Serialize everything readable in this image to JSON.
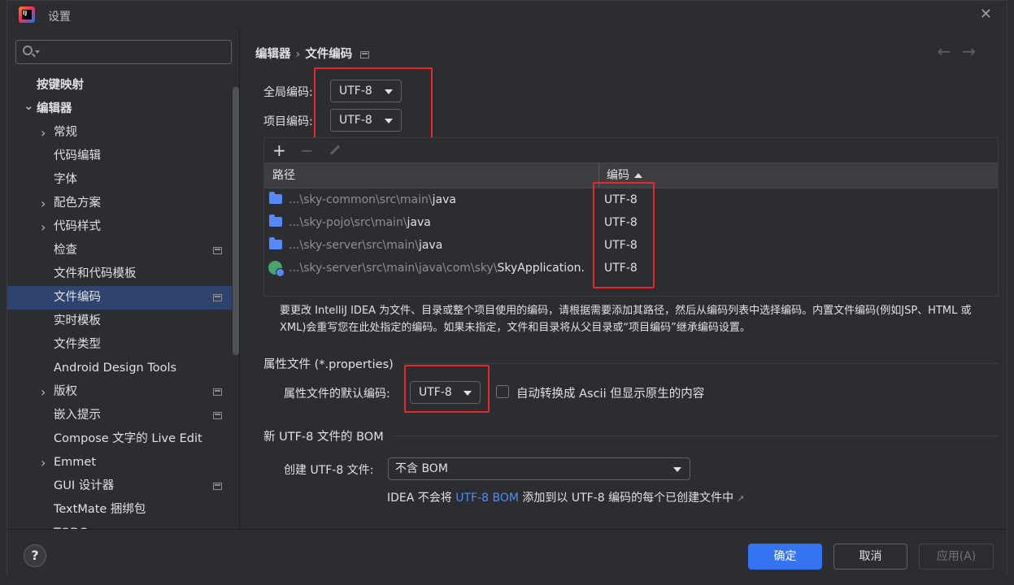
{
  "window": {
    "title": "设置"
  },
  "sidebar": {
    "search_placeholder": "",
    "items": [
      {
        "label": "按键映射",
        "level": 0,
        "bold": true,
        "chevron": ""
      },
      {
        "label": "编辑器",
        "level": 0,
        "bold": true,
        "chevron": "expanded"
      },
      {
        "label": "常规",
        "level": 1,
        "chevron": "collapsed"
      },
      {
        "label": "代码编辑",
        "level": 1,
        "chevron": ""
      },
      {
        "label": "字体",
        "level": 1,
        "chevron": ""
      },
      {
        "label": "配色方案",
        "level": 1,
        "chevron": "collapsed"
      },
      {
        "label": "代码样式",
        "level": 1,
        "chevron": "collapsed"
      },
      {
        "label": "检查",
        "level": 1,
        "chevron": "",
        "project_icon": true
      },
      {
        "label": "文件和代码模板",
        "level": 1,
        "chevron": ""
      },
      {
        "label": "文件编码",
        "level": 1,
        "chevron": "",
        "project_icon": true,
        "selected": true
      },
      {
        "label": "实时模板",
        "level": 1,
        "chevron": ""
      },
      {
        "label": "文件类型",
        "level": 1,
        "chevron": ""
      },
      {
        "label": "Android Design Tools",
        "level": 1,
        "chevron": ""
      },
      {
        "label": "版权",
        "level": 1,
        "chevron": "collapsed",
        "project_icon": true
      },
      {
        "label": "嵌入提示",
        "level": 1,
        "chevron": "",
        "project_icon": true
      },
      {
        "label": "Compose 文字的 Live Edit",
        "level": 1,
        "chevron": ""
      },
      {
        "label": "Emmet",
        "level": 1,
        "chevron": "collapsed"
      },
      {
        "label": "GUI 设计器",
        "level": 1,
        "chevron": "",
        "project_icon": true
      },
      {
        "label": "TextMate 捆绑包",
        "level": 1,
        "chevron": ""
      },
      {
        "label": "TODO",
        "level": 1,
        "chevron": ""
      }
    ]
  },
  "main": {
    "breadcrumb": {
      "parent": "编辑器",
      "separator": "›",
      "current": "文件编码"
    },
    "nav": {
      "back": "←",
      "forward": "→"
    },
    "global_encoding": {
      "label": "全局编码:",
      "value": "UTF-8"
    },
    "project_encoding": {
      "label": "项目编码:",
      "value": "UTF-8"
    },
    "table": {
      "toolbar": {
        "add": "+",
        "remove": "−"
      },
      "columns": {
        "path": "路径",
        "encoding": "编码"
      },
      "rows": [
        {
          "path_prefix": "...\\sky-common\\src\\main\\",
          "path_highlight": "java",
          "encoding": "UTF-8",
          "icon": "folder-icon"
        },
        {
          "path_prefix": "...\\sky-pojo\\src\\main\\",
          "path_highlight": "java",
          "encoding": "UTF-8",
          "icon": "folder-icon"
        },
        {
          "path_prefix": "...\\sky-server\\src\\main\\",
          "path_highlight": "java",
          "encoding": "UTF-8",
          "icon": "folder-icon"
        },
        {
          "path_prefix": "...\\sky-server\\src\\main\\java\\com\\sky\\",
          "path_highlight": "SkyApplication.",
          "encoding": "UTF-8",
          "icon": "class-icon"
        }
      ]
    },
    "help_text": "要更改 IntelliJ IDEA 为文件、目录或整个项目使用的编码，请根据需要添加其路径，然后从编码列表中选择编码。内置文件编码(例如JSP、HTML 或 XML)会重写您在此处指定的编码。如果未指定，文件和目录将从父目录或“项目编码”继承编码设置。",
    "properties": {
      "section_title": "属性文件 (*.properties)",
      "default_encoding_label": "属性文件的默认编码:",
      "default_encoding_value": "UTF-8",
      "checkbox_label": "自动转换成 Ascii 但显示原生的内容"
    },
    "bom": {
      "section_title": "新 UTF-8 文件的 BOM",
      "create_label": "创建 UTF-8 文件:",
      "create_value": "不含 BOM",
      "note_prefix": "IDEA 不会将 ",
      "note_link": "UTF-8 BOM",
      "note_suffix": " 添加到以 UTF-8 编码的每个已创建文件中",
      "note_ext": "↗"
    }
  },
  "footer": {
    "help": "?",
    "ok": "确定",
    "cancel": "取消",
    "apply": "应用(A)"
  },
  "colors": {
    "accent": "#3574f0",
    "selection": "#2e436e",
    "annotation_red": "#e8262b",
    "link": "#548af7"
  }
}
